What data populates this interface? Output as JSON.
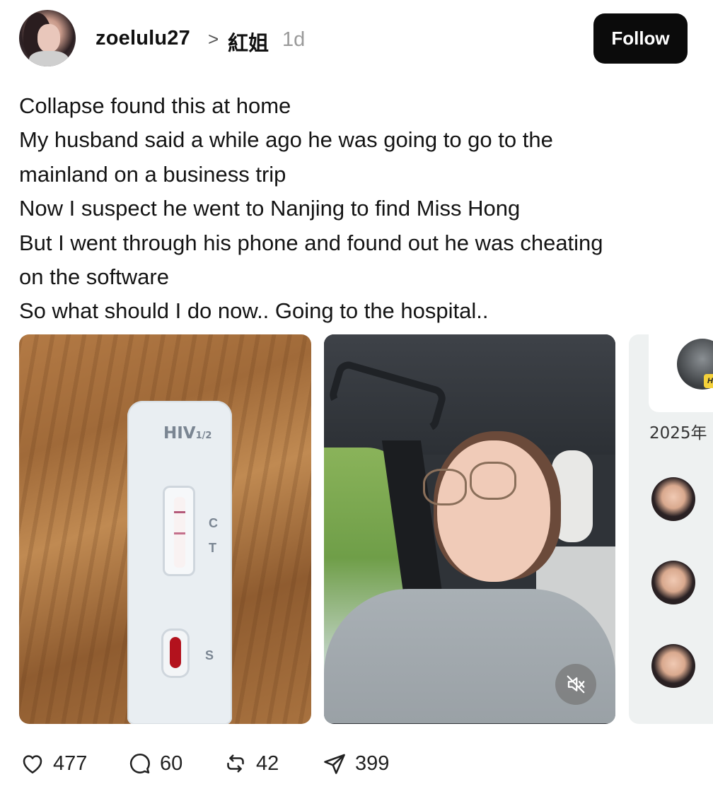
{
  "post": {
    "author": {
      "username": "zoelulu27",
      "topic": "紅姐",
      "time": "1d"
    },
    "follow_label": "Follow",
    "text_lines": [
      "Collapse found this at home",
      "My husband said a while ago he was going to go to the",
      "mainland on a business trip",
      "Now I suspect he went to Nanjing to find Miss Hong",
      "But I went through his phone and found out he was cheating",
      "on the software",
      "So what should I do now.. Going to the hospital.."
    ],
    "media": {
      "test_kit": {
        "label": "HIV",
        "label_sub": "1/2",
        "c": "C",
        "t": "T",
        "s": "S"
      },
      "video_muted_icon": "speaker-muted-icon",
      "third": {
        "badge": "HiFun",
        "year": "2025年"
      }
    },
    "stats": {
      "likes": "477",
      "comments": "60",
      "reposts": "42",
      "shares": "399"
    }
  },
  "colors": {
    "follow_bg": "#0b0b0b",
    "muted_text": "#9a9a9a"
  }
}
